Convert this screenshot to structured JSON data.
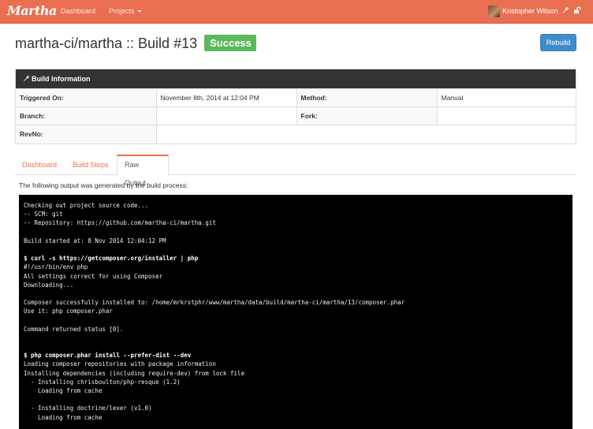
{
  "navbar": {
    "brand": "Martha",
    "dashboard": "Dashboard",
    "projects": "Projects",
    "user": "Kristopher Wilson",
    "color": "#e96f52"
  },
  "header": {
    "title": "martha-ci/martha :: Build #13",
    "status": "Success",
    "rebuild": "Rebuild"
  },
  "build_info": {
    "heading": "Build Information",
    "triggered_label": "Triggered On:",
    "triggered_value": "November 8th, 2014 at 12:04 PM",
    "method_label": "Method:",
    "method_value": "Manual",
    "branch_label": "Branch:",
    "branch_value": "",
    "fork_label": "Fork:",
    "fork_value": "",
    "revno_label": "RevNo:",
    "revno_value": ""
  },
  "tabs": [
    "Dashboard",
    "Build Steps",
    "Raw Output"
  ],
  "active_tab": "Raw Output",
  "output": {
    "intro": "The following output was generated by the build process:",
    "lines": [
      {
        "text": "Checking out project source code...",
        "bold": false
      },
      {
        "text": "-- SCM: git",
        "bold": false
      },
      {
        "text": "-- Repository: https://github.com/martha-ci/martha.git",
        "bold": false
      },
      {
        "text": "",
        "bold": false
      },
      {
        "text": "Build started at: 8 Nov 2014 12:04:12 PM",
        "bold": false
      },
      {
        "text": "",
        "bold": false
      },
      {
        "text": "$ curl -s https://getcomposer.org/installer | php",
        "bold": true
      },
      {
        "text": "#!/usr/bin/env php",
        "bold": false
      },
      {
        "text": "All settings correct for using Composer",
        "bold": false
      },
      {
        "text": "Downloading...",
        "bold": false
      },
      {
        "text": "",
        "bold": false
      },
      {
        "text": "Composer successfully installed to: /home/mrkrstphr/www/martha/data/build/martha-ci/martha/13/composer.phar",
        "bold": false
      },
      {
        "text": "Use it: php composer.phar",
        "bold": false
      },
      {
        "text": "",
        "bold": false
      },
      {
        "text": "Command returned status [0].",
        "bold": false
      },
      {
        "text": "",
        "bold": false
      },
      {
        "text": "",
        "bold": false
      },
      {
        "text": "$ php composer.phar install --prefer-dist --dev",
        "bold": true
      },
      {
        "text": "Loading composer repositories with package information",
        "bold": false
      },
      {
        "text": "Installing dependencies (including require-dev) from lock file",
        "bold": false
      },
      {
        "text": "  - Installing chrisboulton/php-resque (1.2)",
        "bold": false
      },
      {
        "text": "    Loading from cache",
        "bold": false
      },
      {
        "text": "",
        "bold": false
      },
      {
        "text": "  - Installing doctrine/lexer (v1.0)",
        "bold": false
      },
      {
        "text": "    Loading from cache",
        "bold": false
      }
    ]
  }
}
